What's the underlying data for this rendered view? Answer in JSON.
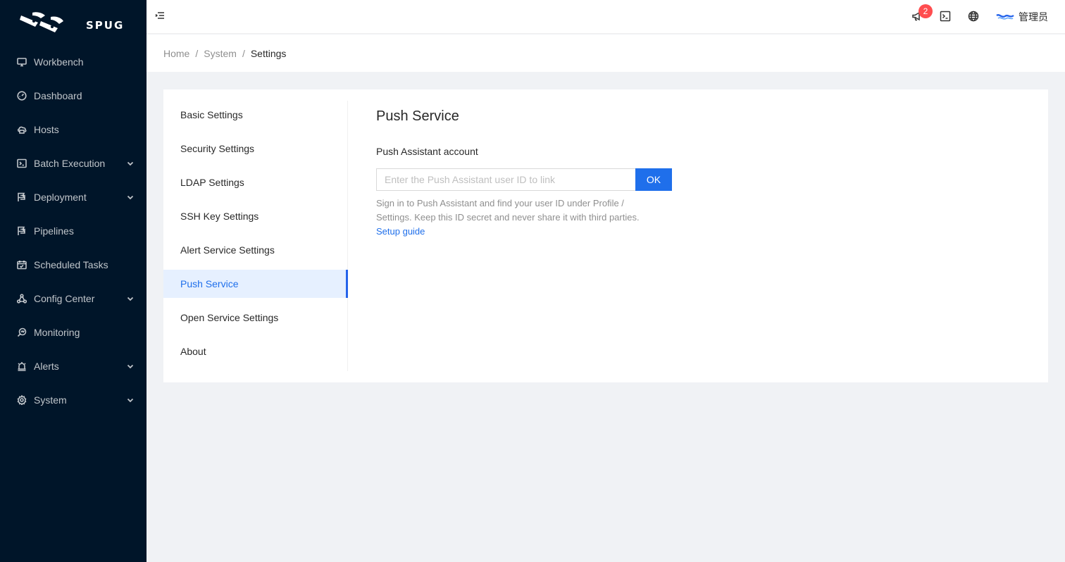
{
  "brand": {
    "name": "SPUG"
  },
  "sidebar": {
    "items": [
      {
        "label": "Workbench",
        "icon": "desktop-icon",
        "has_submenu": false
      },
      {
        "label": "Dashboard",
        "icon": "dashboard-icon",
        "has_submenu": false
      },
      {
        "label": "Hosts",
        "icon": "cloud-server-icon",
        "has_submenu": false
      },
      {
        "label": "Batch Execution",
        "icon": "code-icon",
        "has_submenu": true
      },
      {
        "label": "Deployment",
        "icon": "flag-icon",
        "has_submenu": true
      },
      {
        "label": "Pipelines",
        "icon": "flag-icon",
        "has_submenu": false
      },
      {
        "label": "Scheduled Tasks",
        "icon": "schedule-icon",
        "has_submenu": false
      },
      {
        "label": "Config Center",
        "icon": "deployment-unit-icon",
        "has_submenu": true
      },
      {
        "label": "Monitoring",
        "icon": "monitor-icon",
        "has_submenu": false
      },
      {
        "label": "Alerts",
        "icon": "alert-icon",
        "has_submenu": true
      },
      {
        "label": "System",
        "icon": "setting-icon",
        "has_submenu": true
      }
    ]
  },
  "header": {
    "notification_count": "2",
    "user_name": "管理员"
  },
  "breadcrumb": [
    "Home",
    "System",
    "Settings"
  ],
  "settings_menu": {
    "items": [
      "Basic Settings",
      "Security Settings",
      "LDAP Settings",
      "SSH Key Settings",
      "Alert Service Settings",
      "Push Service",
      "Open Service Settings",
      "About"
    ],
    "active_index": 5
  },
  "panel": {
    "title": "Push Service",
    "field_label": "Push Assistant account",
    "input_value": "",
    "input_placeholder": "Enter the Push Assistant user ID to link",
    "ok_label": "OK",
    "help_text": "Sign in to Push Assistant and find your user ID under Profile / Settings. Keep this ID secret and never share it with third parties.",
    "help_link": "Setup guide"
  },
  "colors": {
    "sidebar_bg": "#001529",
    "primary": "#1f6feb",
    "badge": "#ff4d4f",
    "active_bg": "#e6f0ff"
  }
}
